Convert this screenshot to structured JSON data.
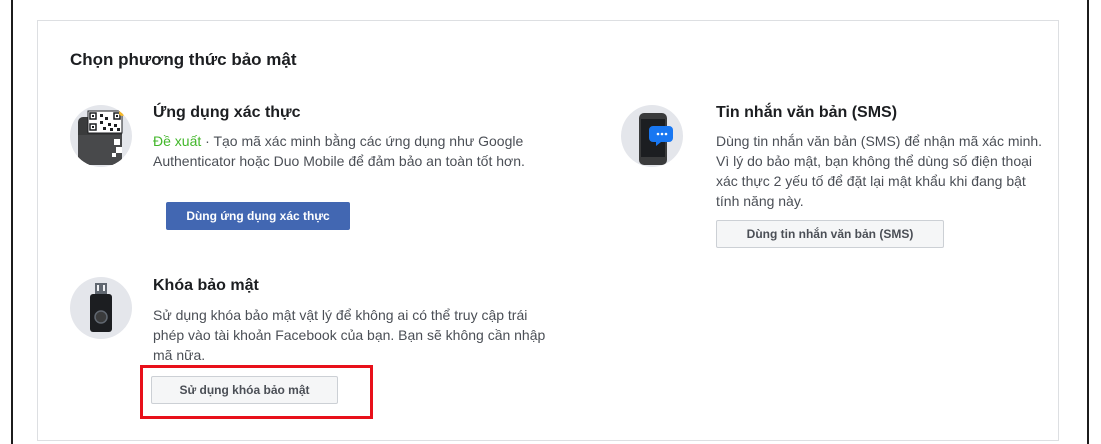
{
  "section": {
    "title": "Chọn phương thức bảo mật"
  },
  "options": {
    "auth_app": {
      "icon": "qr-phone-icon",
      "title": "Ứng dụng xác thực",
      "recommended_label": "Đề xuất",
      "separator": " · ",
      "description": "Tạo mã xác minh bằng các ứng dụng như Google Authenticator hoặc Duo Mobile để đảm bảo an toàn tốt hơn.",
      "button_label": "Dùng ứng dụng xác thực"
    },
    "sms": {
      "icon": "sms-phone-icon",
      "title": "Tin nhắn văn bản (SMS)",
      "description": "Dùng tin nhắn văn bản (SMS) để nhận mã xác minh. Vì lý do bảo mật, bạn không thể dùng số điện thoại xác thực 2 yếu tố để đặt lại mật khẩu khi đang bật tính năng này.",
      "button_label": "Dùng tin nhắn văn bản (SMS)"
    },
    "security_key": {
      "icon": "usb-key-icon",
      "title": "Khóa bảo mật",
      "description": "Sử dụng khóa bảo mật vật lý để không ai có thể truy cập trái phép vào tài khoản Facebook của bạn. Bạn sẽ không cần nhập mã nữa.",
      "button_label": "Sử dụng khóa bảo mật"
    }
  },
  "colors": {
    "primary_button": "#4267b2",
    "recommended_text": "#42b72a",
    "highlight_box": "#e8101a",
    "icon_bg": "#e4e6eb"
  }
}
